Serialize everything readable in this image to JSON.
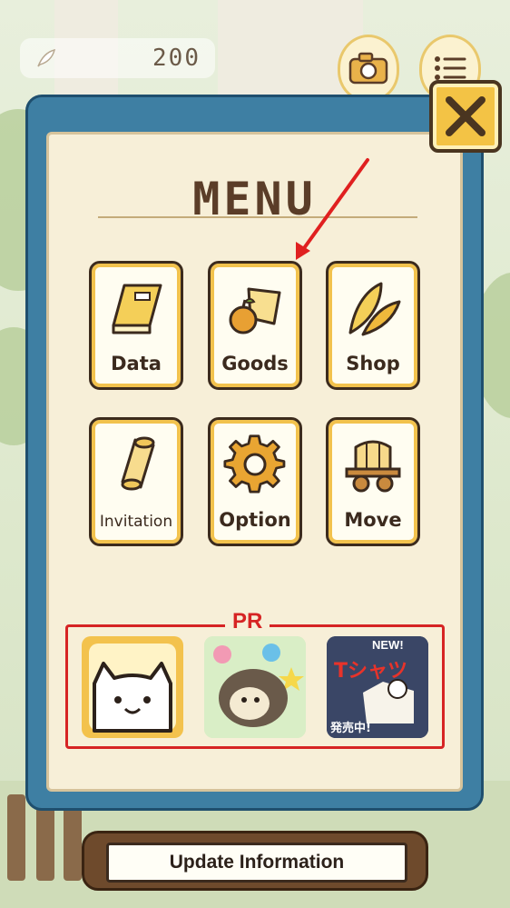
{
  "hud": {
    "currency_value": "200",
    "currency_icon": "feather-icon",
    "camera_icon": "camera-icon",
    "list_icon": "list-icon"
  },
  "menu": {
    "title": "MENU",
    "buttons": [
      {
        "label": "Data",
        "icon": "book-icon"
      },
      {
        "label": "Goods",
        "icon": "goods-icon"
      },
      {
        "label": "Shop",
        "icon": "feathers-icon"
      },
      {
        "label": "Invitation",
        "icon": "scroll-icon"
      },
      {
        "label": "Option",
        "icon": "gear-icon"
      },
      {
        "label": "Move",
        "icon": "wagon-icon"
      }
    ]
  },
  "pr": {
    "label": "PR",
    "ads": [
      {
        "icon": "neko-atsume-app-icon"
      },
      {
        "icon": "hedgehog-app-icon"
      },
      {
        "icon": "tshirt-promo-icon",
        "badge": "NEW!",
        "title": "Tシャツ",
        "footer": "発売中!"
      }
    ]
  },
  "footer": {
    "update_label": "Update Information"
  },
  "colors": {
    "panel_blue": "#3e7fa3",
    "panel_cream": "#f7efd8",
    "button_gold": "#f2c24d",
    "pr_red": "#d62424",
    "text_brown": "#5b3d28"
  }
}
